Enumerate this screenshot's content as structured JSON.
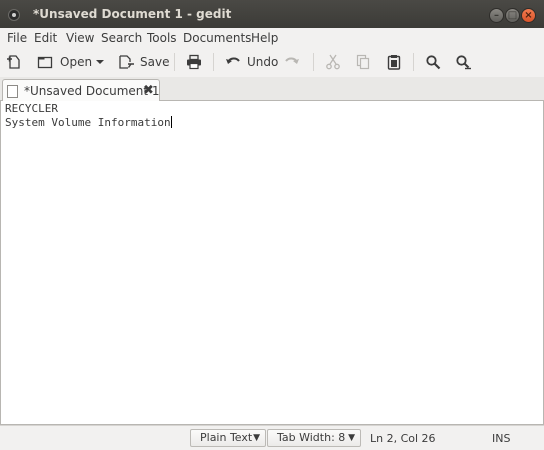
{
  "window": {
    "title": "*Unsaved Document 1 - gedit",
    "accent_close": "#e95420"
  },
  "menubar": {
    "items": [
      "File",
      "Edit",
      "View",
      "Search",
      "Tools",
      "Documents",
      "Help"
    ]
  },
  "toolbar": {
    "new_icon": "new-document-icon",
    "open_label": "Open",
    "save_label": "Save",
    "print_icon": "printer-icon",
    "undo_label": "Undo",
    "redo_icon": "redo-icon",
    "cut_icon": "scissors-icon",
    "copy_icon": "copy-icon",
    "paste_icon": "clipboard-icon",
    "find_icon": "search-icon",
    "replace_icon": "find-replace-icon"
  },
  "tabs": [
    {
      "label": "*Unsaved Document 1",
      "close_glyph": "✖"
    }
  ],
  "editor": {
    "lines": [
      "RECYCLER",
      "System Volume Information"
    ]
  },
  "statusbar": {
    "language": "Plain Text",
    "tab_width": "Tab Width:  8",
    "position": "Ln 2, Col 26",
    "mode": "INS"
  }
}
